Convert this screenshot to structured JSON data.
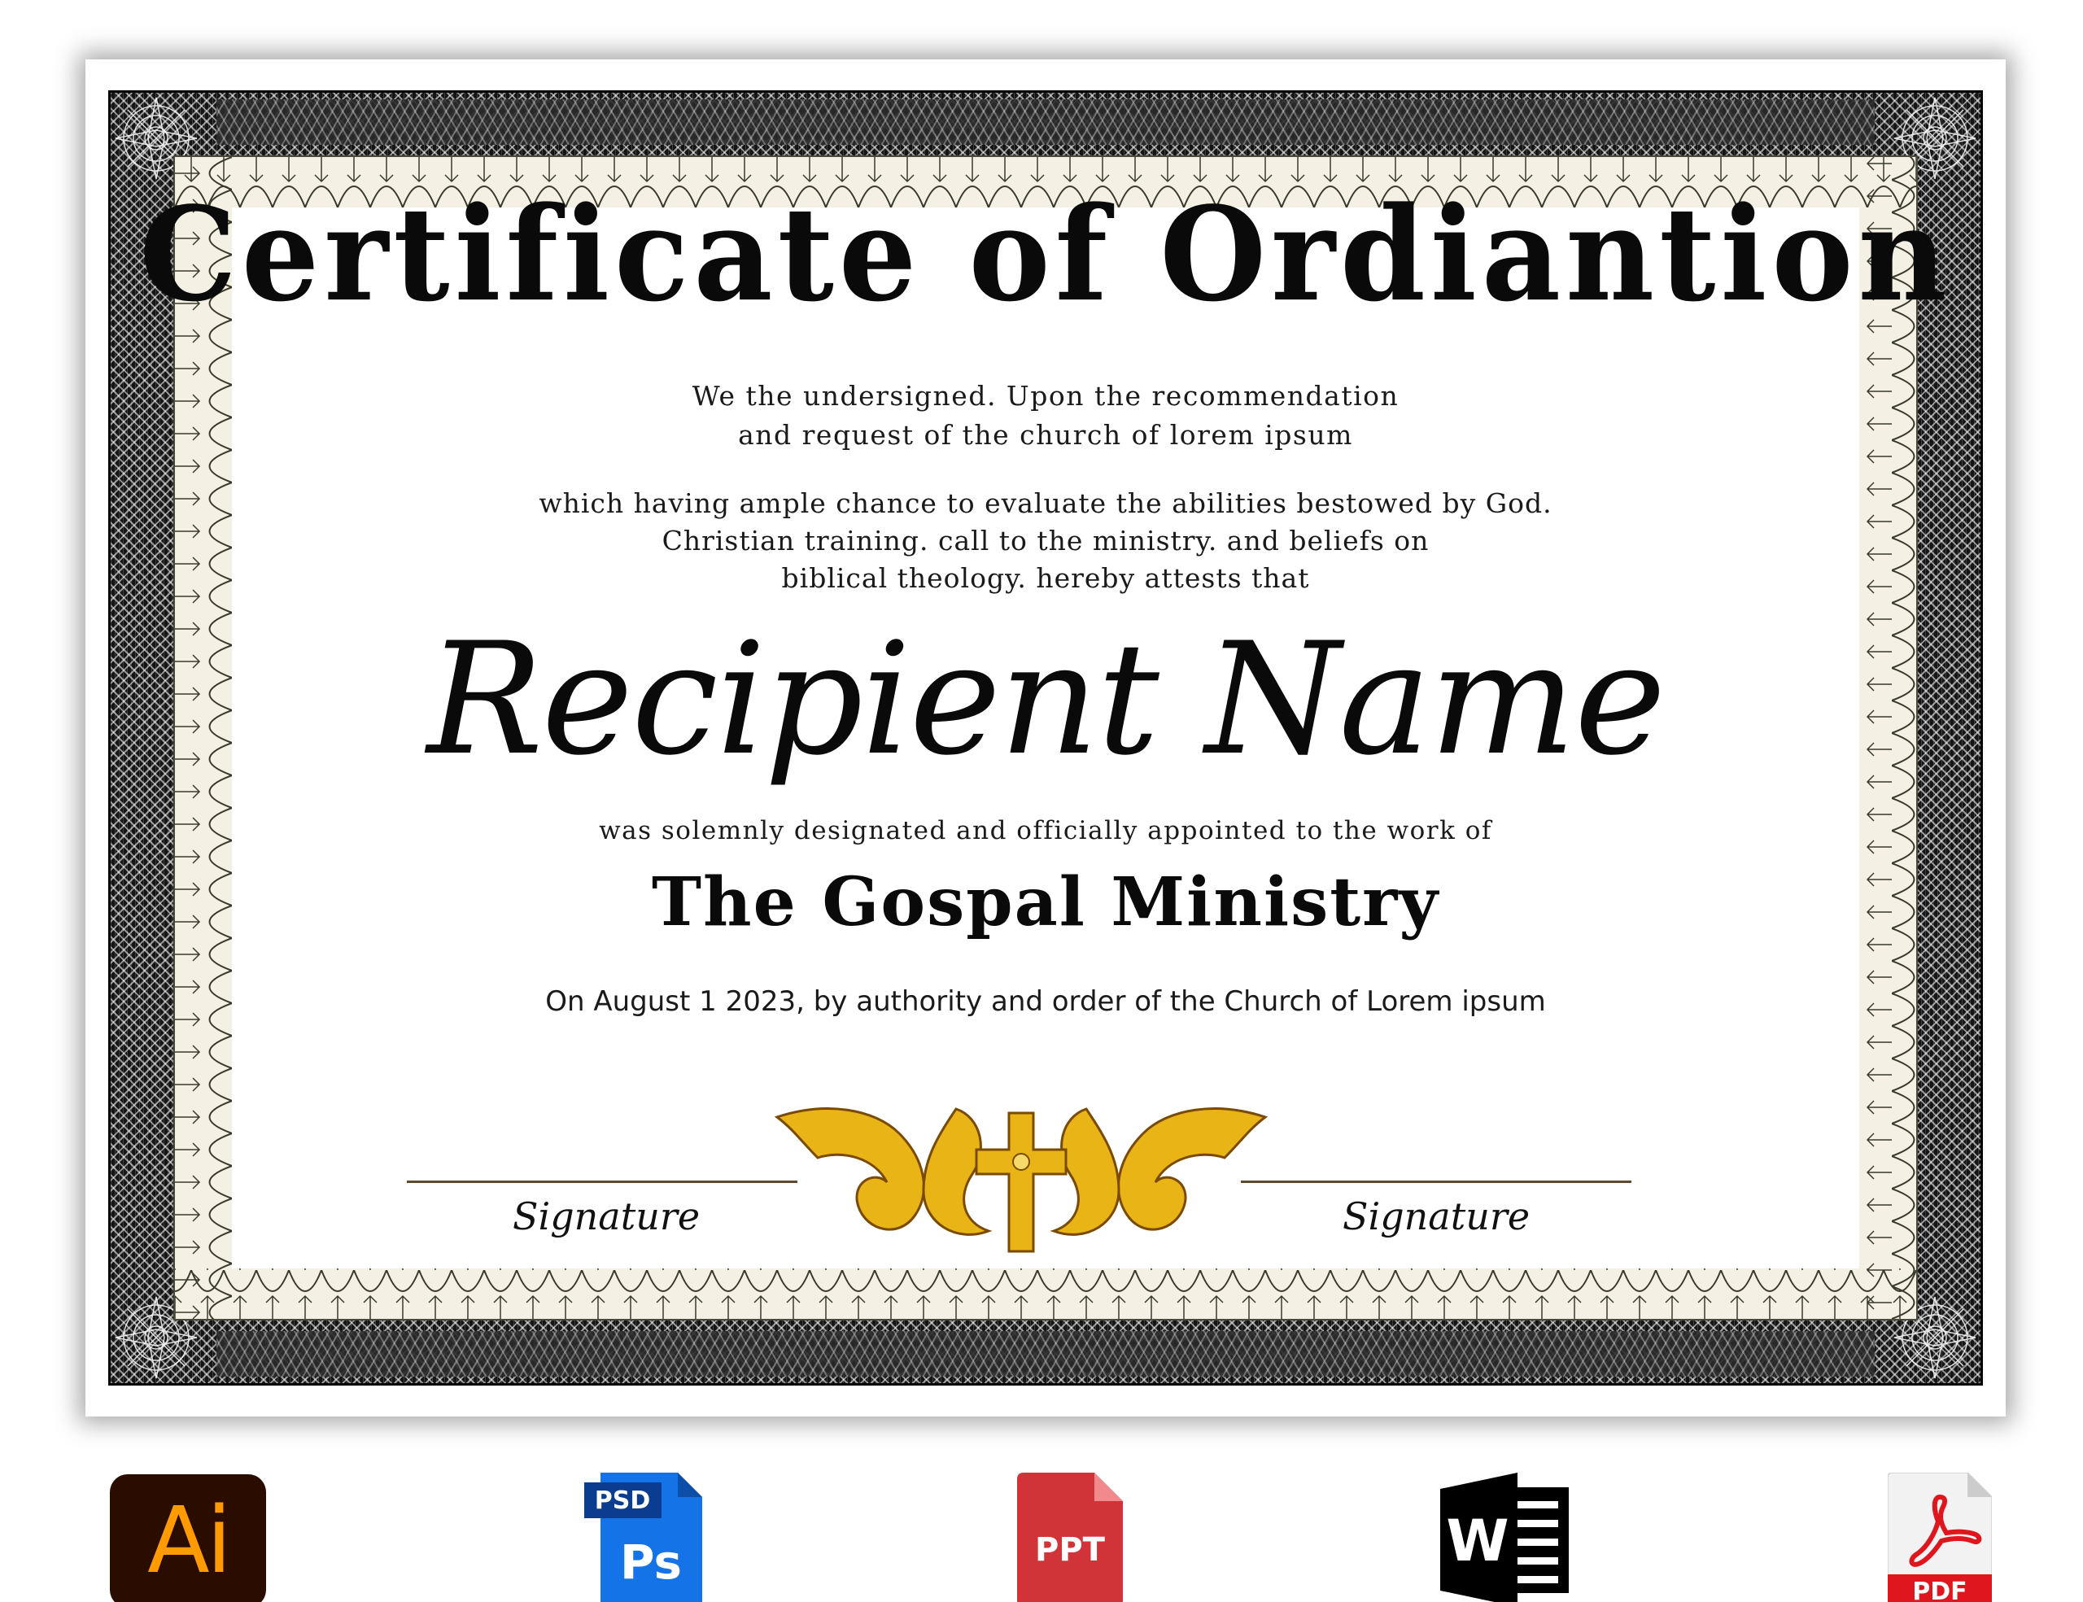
{
  "certificate": {
    "title": "Certificate of Ordiantion",
    "intro_lines": [
      "We the undersigned. Upon the recommendation",
      "and request of the church of lorem ipsum"
    ],
    "body_lines": [
      "which having ample chance to evaluate the abilities bestowed by God.",
      "Christian training. call to the ministry. and beliefs on",
      "biblical theology. hereby attests that"
    ],
    "recipient_name": "Recipient Name",
    "appointed_text": "was solemnly designated and officially appointed to the work of",
    "ministry": "The Gospal Ministry",
    "date_line": "On August 1 2023, by authority and order of the Church of Lorem ipsum",
    "signature_left": "Signature",
    "signature_right": "Signature",
    "emblem": "gold-cross-ornament-icon"
  },
  "formats": [
    {
      "label": "Ai",
      "icon": "adobe-illustrator-icon",
      "color": "#ff9a00"
    },
    {
      "label": "PSD",
      "sublabel": "Ps",
      "icon": "photoshop-icon",
      "color": "#1473e6"
    },
    {
      "label": "PPT",
      "icon": "powerpoint-icon",
      "color": "#d13438"
    },
    {
      "label": "W",
      "icon": "word-icon",
      "color": "#000000"
    },
    {
      "label": "PDF",
      "icon": "pdf-icon",
      "color": "#e0161e"
    }
  ],
  "colors": {
    "frame": "#151515",
    "lace": "#f4f1e4",
    "gold": "#e8b416",
    "gold_dark": "#8a5a00"
  }
}
